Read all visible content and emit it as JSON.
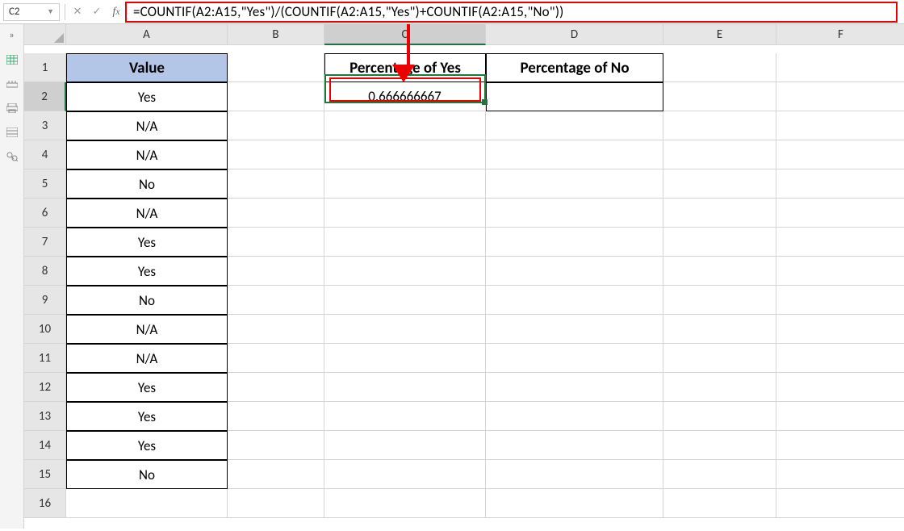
{
  "name_box": {
    "value": "C2"
  },
  "formula_bar": {
    "text": "=COUNTIF(A2:A15,\"Yes\")/(COUNTIF(A2:A15,\"Yes\")+COUNTIF(A2:A15,\"No\"))"
  },
  "columns": [
    "A",
    "B",
    "C",
    "D",
    "E",
    "F"
  ],
  "selected_column": "C",
  "selected_row": 2,
  "headers": {
    "A1": "Value",
    "C1": "Percentage of Yes",
    "D1": "Percentage of No"
  },
  "col_a": {
    "2": "Yes",
    "3": "N/A",
    "4": "N/A",
    "5": "No",
    "6": "N/A",
    "7": "Yes",
    "8": "Yes",
    "9": "No",
    "10": "N/A",
    "11": "N/A",
    "12": "Yes",
    "13": "Yes",
    "14": "Yes",
    "15": "No"
  },
  "result": {
    "C2": "0.666666667"
  },
  "row_labels": [
    "1",
    "2",
    "3",
    "4",
    "5",
    "6",
    "7",
    "8",
    "9",
    "10",
    "11",
    "12",
    "13",
    "14",
    "15",
    "16"
  ],
  "icons": {
    "chevrons": "»",
    "cancel": "✕",
    "enter": "✓"
  }
}
